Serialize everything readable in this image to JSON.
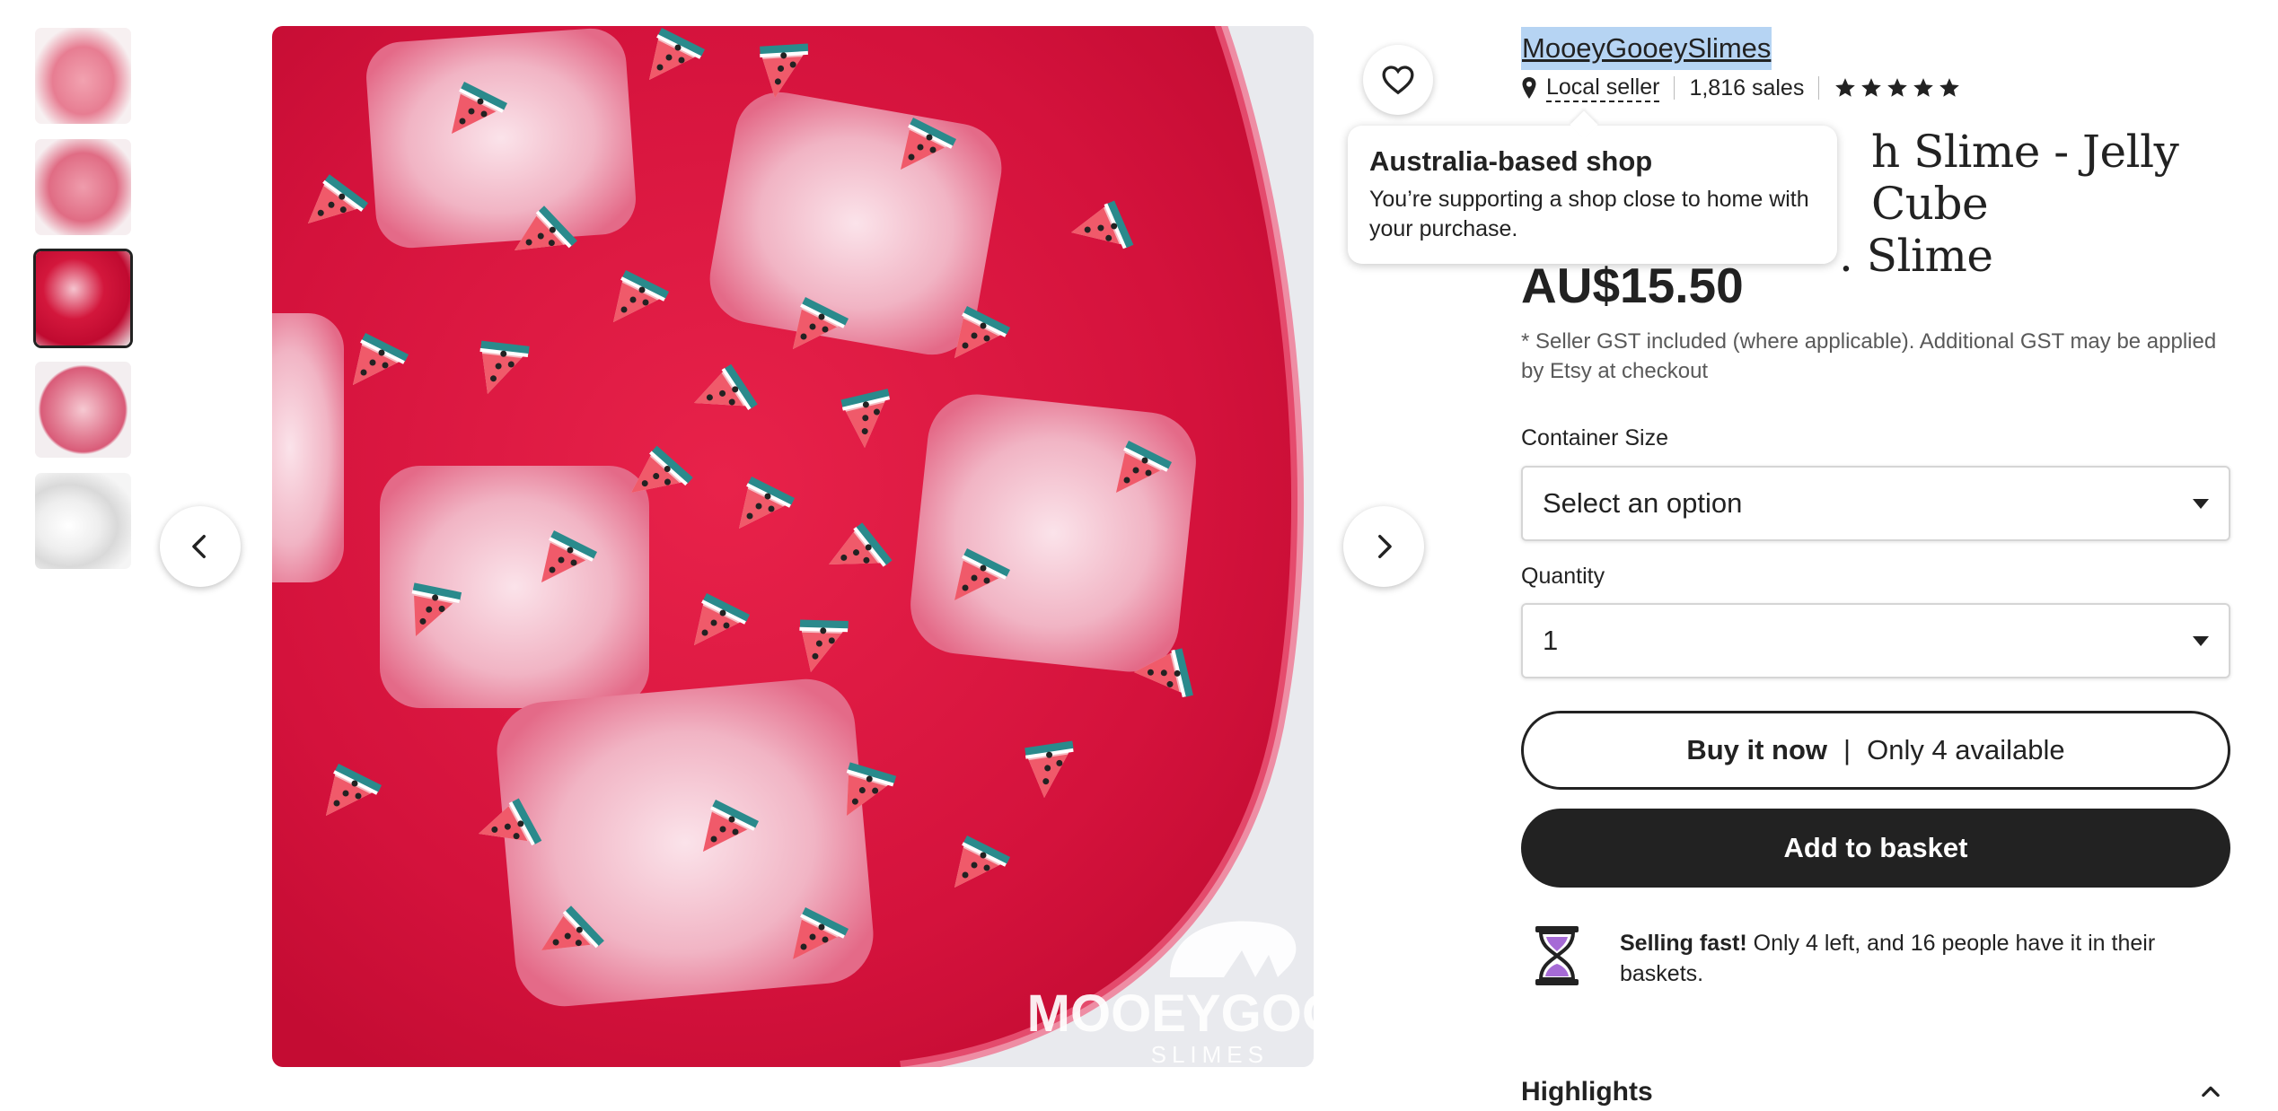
{
  "gallery": {
    "thumbnails": [
      {
        "name": "thumb-1",
        "active": false
      },
      {
        "name": "thumb-2",
        "active": false
      },
      {
        "name": "thumb-3",
        "active": true
      },
      {
        "name": "thumb-4",
        "active": false
      },
      {
        "name": "thumb-5",
        "active": false
      }
    ],
    "watermark_line1": "MOOEYGOOEY",
    "watermark_line2": "SLIMES",
    "prev_icon": "chevron-left-icon",
    "next_icon": "chevron-right-icon",
    "favorite_icon": "heart-icon"
  },
  "shop": {
    "name": "MooeyGooeySlimes",
    "local_label": "Local seller",
    "sales": "1,816 sales",
    "rating_stars": 5
  },
  "listing": {
    "title_visible": "h Slime - Jelly Cube\n. Slime",
    "price": "AU$15.50",
    "gst_note": "* Seller GST included (where applicable). Additional GST may be applied by Etsy at checkout"
  },
  "options": {
    "container_label": "Container Size",
    "container_value": "Select an option",
    "quantity_label": "Quantity",
    "quantity_value": "1"
  },
  "actions": {
    "buy_now": "Buy it now",
    "buy_separator": "|",
    "availability": "Only 4 available",
    "add_to_basket": "Add to basket"
  },
  "selling_fast": {
    "label": "Selling fast!",
    "text": "Only 4 left, and 16 people have it in their baskets."
  },
  "highlights": {
    "label": "Highlights"
  },
  "tooltip": {
    "title": "Australia-based shop",
    "body": "You’re supporting a shop close to home with your purchase."
  },
  "colors": {
    "slime_red": "#d8163f",
    "cube_pink": "#f3c3cf",
    "text_dark": "#222222",
    "selection_blue": "#b6d4f3"
  }
}
